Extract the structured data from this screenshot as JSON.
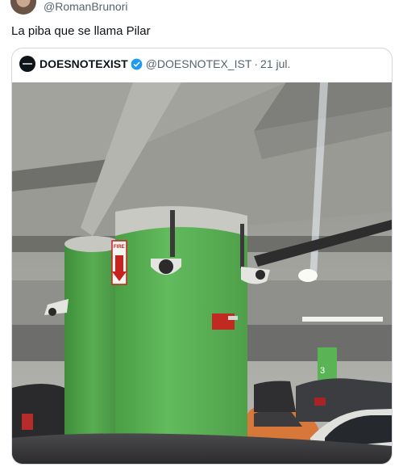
{
  "author": {
    "handle": "@RomanBrunori"
  },
  "tweet": {
    "text": "La piba que se llama Pilar"
  },
  "quote": {
    "name": "DOESNOTEXIST",
    "handle": "@DOESNOTEX_IST",
    "separator": "·",
    "date": "21 jul."
  },
  "photo": {
    "fire_sign": "FIRE",
    "level_marker": "3"
  },
  "colors": {
    "pillar_green": "#5ab455",
    "verified_blue": "#1d9bf0"
  }
}
